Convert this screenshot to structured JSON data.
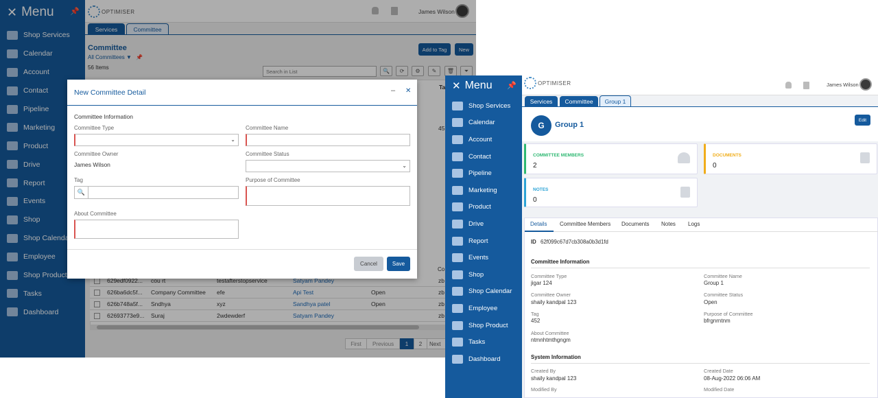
{
  "winA": {
    "menu_title": "Menu",
    "menu_items": [
      "Shop Services",
      "Calendar",
      "Account",
      "Contact",
      "Pipeline",
      "Marketing",
      "Product",
      "Drive",
      "Report",
      "Events",
      "Shop",
      "Shop Calendar",
      "Employee",
      "Shop Product",
      "Tasks",
      "Dashboard"
    ],
    "logo_text": "OPTIMISER",
    "user_name": "James Wilson",
    "tabs": [
      "Services",
      "Committee"
    ],
    "page_title": "Committee",
    "view_select": "All Committees",
    "item_count": "56 Items",
    "add_to_tag": "Add to Tag",
    "new_label": "New",
    "search_placeholder": "Search in List",
    "col_headers": {
      "ta": "Ta",
      "co": "Co"
    },
    "partial_value": "45",
    "rows": [
      {
        "id": "629edf0922...",
        "name": "cou rt",
        "purpose": "testafterstopservice",
        "owner": "Satyam Pandey",
        "status": "",
        "extra": "zb"
      },
      {
        "id": "626ba6dc5f...",
        "name": "Company Committee",
        "purpose": "efe",
        "owner": "Api Test",
        "status": "Open",
        "extra": "zb"
      },
      {
        "id": "626b748a5f...",
        "name": "Sndhya",
        "purpose": "xyz",
        "owner": "Sandhya patel",
        "status": "Open",
        "extra": "zb"
      },
      {
        "id": "62693773e9...",
        "name": "Suraj",
        "purpose": "2wdewderf",
        "owner": "Satyam Pandey",
        "status": "",
        "extra": "zb"
      }
    ],
    "pager": {
      "first": "First",
      "previous": "Previous",
      "p1": "1",
      "p2": "2",
      "next": "Next"
    },
    "modal": {
      "title": "New Committee Detail",
      "section": "Committee Information",
      "type_label": "Committee Type",
      "name_label": "Committee Name",
      "owner_label": "Committee Owner",
      "owner_value": "James Wilson",
      "status_label": "Committee Status",
      "tag_label": "Tag",
      "purpose_label": "Purpose of Committee",
      "about_label": "About Committee",
      "cancel": "Cancel",
      "save": "Save"
    }
  },
  "winB": {
    "menu_title": "Menu",
    "menu_items": [
      "Shop Services",
      "Calendar",
      "Account",
      "Contact",
      "Pipeline",
      "Marketing",
      "Product",
      "Drive",
      "Report",
      "Events",
      "Shop",
      "Shop Calendar",
      "Employee",
      "Shop Product",
      "Tasks",
      "Dashboard"
    ],
    "logo_text": "OPTIMISER",
    "user_name": "James Wilson",
    "tabs": [
      "Services",
      "Committee",
      "Group 1"
    ],
    "avatar_letter": "G",
    "record_title": "Group 1",
    "edit": "Edit",
    "cards": {
      "members_label": "COMMITTEE MEMBERS",
      "members_value": "2",
      "documents_label": "DOCUMENTS",
      "documents_value": "0",
      "notes_label": "NOTES",
      "notes_value": "0"
    },
    "detail_tabs": [
      "Details",
      "Committee Members",
      "Documents",
      "Notes",
      "Logs"
    ],
    "id_label": "ID",
    "id_value": "62f099c67d7cb308a0b3d1fd",
    "sec_committee": "Committee Information",
    "type_label": "Committee Type",
    "type_value": "jigar 124",
    "name_label": "Committee Name",
    "name_value": "Group 1",
    "owner_label": "Committee Owner",
    "owner_value": "shaily kandpal 123",
    "status_label": "Committee Status",
    "status_value": "Open",
    "tag_label": "Tag",
    "tag_value": "452",
    "purpose_label": "Purpose of Committee",
    "purpose_value": "bfrgnrntnm",
    "about_label": "About Committee",
    "about_value": "ntmnhtmthgngm",
    "sec_system": "System Information",
    "created_by_label": "Created By",
    "created_by_value": "shaily kandpal 123",
    "created_date_label": "Created Date",
    "created_date_value": "08-Aug-2022 06:06 AM",
    "modified_by_label": "Modified By",
    "modified_date_label": "Modified Date"
  },
  "colors": {
    "brand": "#155a9d",
    "members": "#2eb872",
    "documents": "#f0ad1b",
    "notes": "#2ba3d6"
  }
}
